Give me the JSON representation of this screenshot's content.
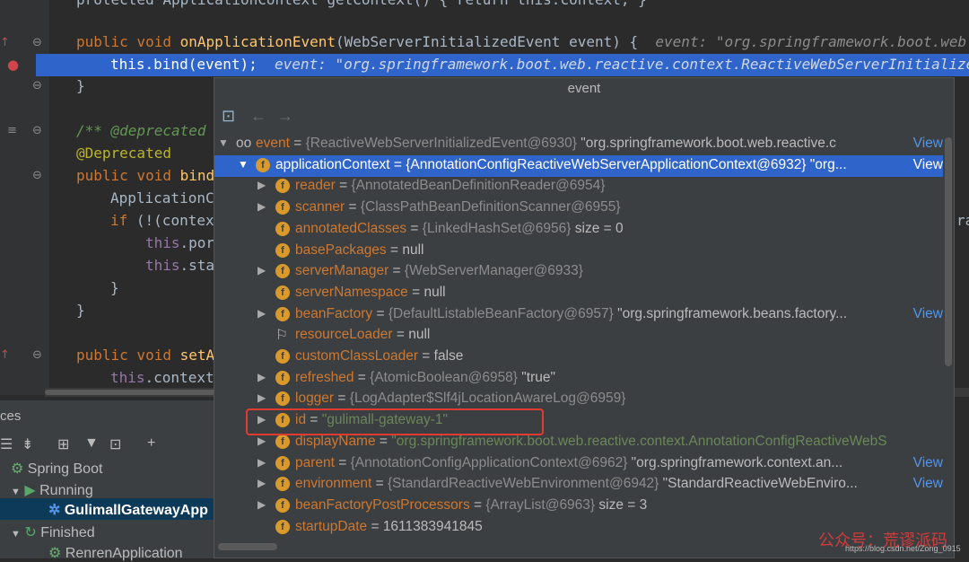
{
  "editor": {
    "lines": {
      "l0": "protected ApplicationContext getContext() { return this.context; }",
      "l1_kw": "public void ",
      "l1_fn": "onApplicationEvent",
      "l1_rest": "(WebServerInitializedEvent event) {",
      "l1_hint": "event: \"org.springframework.boot.web.r",
      "l2_code": "this.bind(event);",
      "l2_hint": "event: \"org.springframework.boot.web.reactive.context.ReactiveWebServerInitialized",
      "l3": "}",
      "l4": "/** @deprecated",
      "l5": "@Deprecated",
      "l6_kw": "public void ",
      "l6_fn": "bind",
      "l7": "ApplicationC",
      "l8_kw": "if ",
      "l8_rest": "(!(contex",
      "l9_th": "this",
      "l9_rest": ".por",
      "l10_th": "this",
      "l10_rest": ".sta",
      "l11": "}",
      "l12": "}",
      "l13_kw": "public void ",
      "l13_fn": "setA",
      "l14_th": "this",
      "l14_rest": ".context",
      "l8_right": "ra"
    }
  },
  "services": {
    "title": "ces",
    "items": {
      "spring_boot": "Spring Boot",
      "running": "Running",
      "gateway": "GulimallGatewayApp",
      "finished": "Finished",
      "renren": "RenrenApplication"
    }
  },
  "popup": {
    "title": "event",
    "rows": [
      {
        "name": "event",
        "type": "{ReactiveWebServerInitializedEvent@6930}",
        "value": "\"org.springframework.boot.web.reactive.c",
        "view": "View"
      },
      {
        "name": "applicationContext",
        "type": "{AnnotationConfigReactiveWebServerApplicationContext@6932}",
        "value": "\"org...",
        "view": "View"
      },
      {
        "name": "reader",
        "type": "{AnnotatedBeanDefinitionReader@6954}",
        "value": "",
        "view": ""
      },
      {
        "name": "scanner",
        "type": "{ClassPathBeanDefinitionScanner@6955}",
        "value": "",
        "view": ""
      },
      {
        "name": "annotatedClasses",
        "type": "{LinkedHashSet@6956}",
        "value": " size = 0",
        "view": ""
      },
      {
        "name": "basePackages",
        "type": "",
        "value": "null",
        "view": ""
      },
      {
        "name": "serverManager",
        "type": "{WebServerManager@6933}",
        "value": "",
        "view": ""
      },
      {
        "name": "serverNamespace",
        "type": "",
        "value": "null",
        "view": ""
      },
      {
        "name": "beanFactory",
        "type": "{DefaultListableBeanFactory@6957}",
        "value": "\"org.springframework.beans.factory...",
        "view": "View"
      },
      {
        "name": "resourceLoader",
        "type": "",
        "value": "null",
        "view": ""
      },
      {
        "name": "customClassLoader",
        "type": "",
        "value": "false",
        "view": ""
      },
      {
        "name": "refreshed",
        "type": "{AtomicBoolean@6958}",
        "value": "\"true\"",
        "view": ""
      },
      {
        "name": "logger",
        "type": "{LogAdapter$Slf4jLocationAwareLog@6959}",
        "value": "",
        "view": ""
      },
      {
        "name": "id",
        "type": "",
        "value": "\"gulimall-gateway-1\"",
        "view": ""
      },
      {
        "name": "displayName",
        "type": "",
        "value": "\"org.springframework.boot.web.reactive.context.AnnotationConfigReactiveWebS",
        "view": ""
      },
      {
        "name": "parent",
        "type": "{AnnotationConfigApplicationContext@6962}",
        "value": "\"org.springframework.context.an...",
        "view": "View"
      },
      {
        "name": "environment",
        "type": "{StandardReactiveWebEnvironment@6942}",
        "value": "\"StandardReactiveWebEnviro...",
        "view": "View"
      },
      {
        "name": "beanFactoryPostProcessors",
        "type": "{ArrayList@6963}",
        "value": " size = 3",
        "view": ""
      },
      {
        "name": "startupDate",
        "type": "",
        "value": "1611383941845",
        "view": ""
      }
    ]
  },
  "watermark": {
    "main": "公众号：荒谬派码",
    "url": "https://blog.csdn.net/Zong_0915"
  }
}
